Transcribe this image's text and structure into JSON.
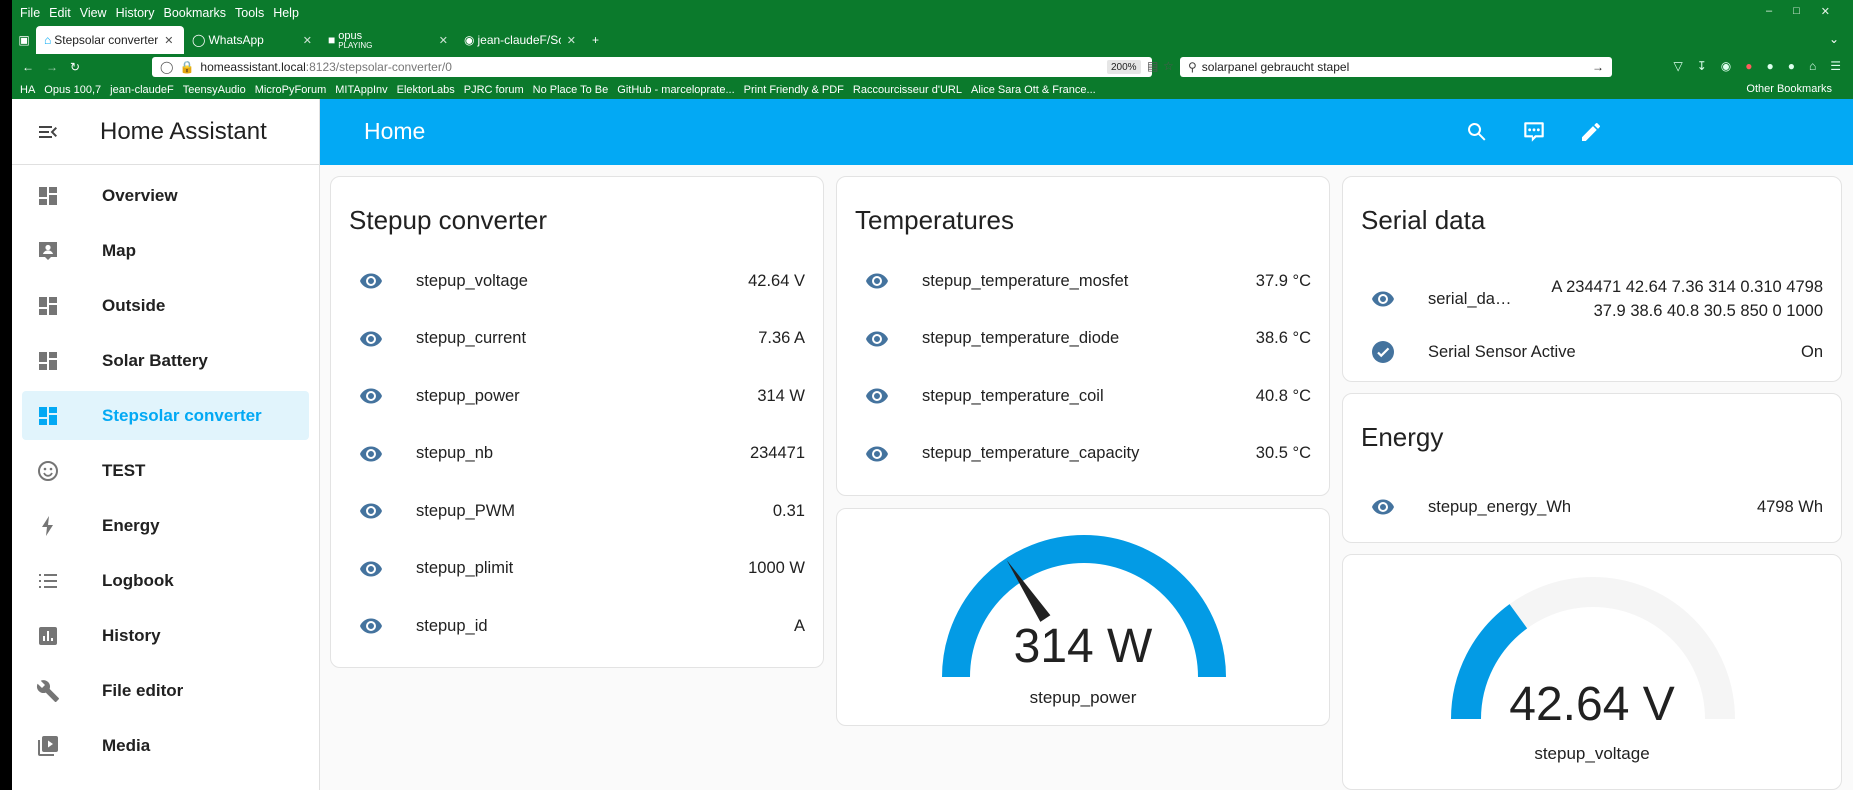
{
  "browser": {
    "menu": [
      "File",
      "Edit",
      "View",
      "History",
      "Bookmarks",
      "Tools",
      "Help"
    ],
    "tabs": [
      {
        "label": "Stepsolar converter -",
        "active": true
      },
      {
        "label": "WhatsApp",
        "active": false
      },
      {
        "label": "opus",
        "sublabel": "PLAYING",
        "active": false
      },
      {
        "label": "jean-claudeF/SolarPс",
        "active": false
      }
    ],
    "url_host": "homeassistant.local",
    "url_path": ":8123/stepsolar-converter/0",
    "zoom": "200%",
    "search_text": "solarpanel gebraucht stapel",
    "bookmarks": [
      "HA",
      "Opus 100,7",
      "jean-claudeF",
      "TeensyAudio",
      "MicroPyForum",
      "MITAppInv",
      "ElektorLabs",
      "PJRC forum",
      "No Place To Be",
      "GitHub - marceloprate...",
      "Print Friendly & PDF",
      "Raccourcisseur d'URL",
      "Alice Sara Ott & France..."
    ],
    "other_bookmarks": "Other Bookmarks"
  },
  "sidebar": {
    "title": "Home Assistant",
    "items": [
      {
        "label": "Overview",
        "icon": "dashboard-icon",
        "selected": false
      },
      {
        "label": "Map",
        "icon": "map-account-icon",
        "selected": false
      },
      {
        "label": "Outside",
        "icon": "dashboard-icon",
        "selected": false
      },
      {
        "label": "Solar Battery",
        "icon": "dashboard-icon",
        "selected": false
      },
      {
        "label": "Stepsolar converter",
        "icon": "dashboard-icon",
        "selected": true
      },
      {
        "label": "TEST",
        "icon": "smiley-icon",
        "selected": false
      },
      {
        "label": "Energy",
        "icon": "lightning-icon",
        "selected": false
      },
      {
        "label": "Logbook",
        "icon": "list-icon",
        "selected": false
      },
      {
        "label": "History",
        "icon": "chart-box-icon",
        "selected": false
      },
      {
        "label": "File editor",
        "icon": "wrench-icon",
        "selected": false
      },
      {
        "label": "Media",
        "icon": "play-box-icon",
        "selected": false
      }
    ]
  },
  "header": {
    "title": "Home"
  },
  "cards": {
    "stepup": {
      "title": "Stepup converter",
      "rows": [
        {
          "name": "stepup_voltage",
          "value": "42.64 V"
        },
        {
          "name": "stepup_current",
          "value": "7.36 A"
        },
        {
          "name": "stepup_power",
          "value": "314 W"
        },
        {
          "name": "stepup_nb",
          "value": "234471"
        },
        {
          "name": "stepup_PWM",
          "value": "0.31"
        },
        {
          "name": "stepup_plimit",
          "value": "1000 W"
        },
        {
          "name": "stepup_id",
          "value": "A"
        }
      ]
    },
    "temps": {
      "title": "Temperatures",
      "rows": [
        {
          "name": "stepup_temperature_mosfet",
          "value": "37.9 °C"
        },
        {
          "name": "stepup_temperature_diode",
          "value": "38.6 °C"
        },
        {
          "name": "stepup_temperature_coil",
          "value": "40.8 °C"
        },
        {
          "name": "stepup_temperature_capacity",
          "value": "30.5 °C"
        }
      ]
    },
    "serial": {
      "title": "Serial data",
      "row1_name": "serial_da…",
      "row1_value_line1": "A 234471 42.64 7.36 314 0.310 4798",
      "row1_value_line2": "37.9 38.6 40.8 30.5 850 0 1000",
      "row2_name": "Serial Sensor Active",
      "row2_value": "On"
    },
    "energy": {
      "title": "Energy",
      "row_name": "stepup_energy_Wh",
      "row_value": "4798 Wh"
    },
    "gauge_power": {
      "value_text": "314 W",
      "name": "stepup_power",
      "needle_fraction": 0.314
    },
    "gauge_voltage": {
      "value_text": "42.64 V",
      "name": "stepup_voltage",
      "fill_fraction": 0.3
    }
  },
  "colors": {
    "primary": "#03a9f4",
    "icon": "#44739e",
    "gauge_fill": "#039be5",
    "gauge_track": "#f5f5f5",
    "browser": "#0b7a2c"
  }
}
